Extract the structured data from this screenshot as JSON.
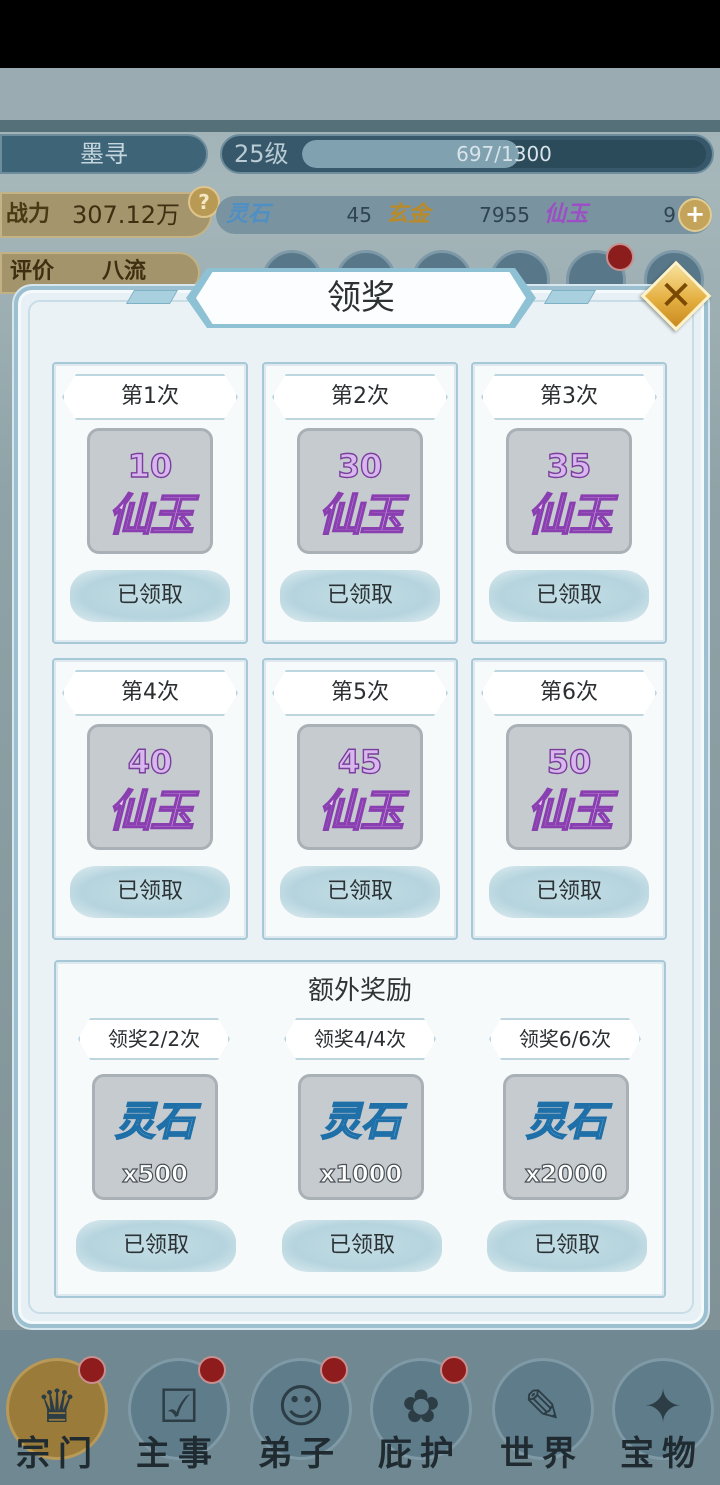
{
  "player": {
    "name": "墨寻",
    "level": "25级",
    "exp": "697/1300",
    "exp_fraction": 0.536,
    "power_label": "战力",
    "power_value": "307.12万",
    "rating_label": "评价",
    "rating_value": "八流"
  },
  "resources": [
    {
      "label": "灵石",
      "value": "45",
      "color": "#4f8fc4"
    },
    {
      "label": "玄金",
      "value": "7955",
      "color": "#b88a2a"
    },
    {
      "label": "仙玉",
      "value": "9",
      "color": "#9c4fc4"
    }
  ],
  "modal": {
    "title": "领奖",
    "close_icon": "close-icon",
    "rewards": [
      {
        "tag": "第1次",
        "amount": "10",
        "item": "仙玉",
        "status": "已领取"
      },
      {
        "tag": "第2次",
        "amount": "30",
        "item": "仙玉",
        "status": "已领取"
      },
      {
        "tag": "第3次",
        "amount": "35",
        "item": "仙玉",
        "status": "已领取"
      },
      {
        "tag": "第4次",
        "amount": "40",
        "item": "仙玉",
        "status": "已领取"
      },
      {
        "tag": "第5次",
        "amount": "45",
        "item": "仙玉",
        "status": "已领取"
      },
      {
        "tag": "第6次",
        "amount": "50",
        "item": "仙玉",
        "status": "已领取"
      }
    ],
    "extra": {
      "title": "额外奖励",
      "items": [
        {
          "tag": "领奖2/2次",
          "item": "灵石",
          "qty": "x500",
          "status": "已领取"
        },
        {
          "tag": "领奖4/4次",
          "item": "灵石",
          "qty": "x1000",
          "status": "已领取"
        },
        {
          "tag": "领奖6/6次",
          "item": "灵石",
          "qty": "x2000",
          "status": "已领取"
        }
      ]
    }
  },
  "bottom_nav": [
    {
      "label": "宗门",
      "icon": "sect-icon",
      "badge": true
    },
    {
      "label": "主事",
      "icon": "task-check-icon",
      "badge": true
    },
    {
      "label": "弟子",
      "icon": "disciple-icon",
      "badge": true
    },
    {
      "label": "庇护",
      "icon": "fish-icon",
      "badge": true
    },
    {
      "label": "世界",
      "icon": "scroll-icon",
      "badge": false
    },
    {
      "label": "宝物",
      "icon": "treasure-bag-icon",
      "badge": false
    }
  ]
}
